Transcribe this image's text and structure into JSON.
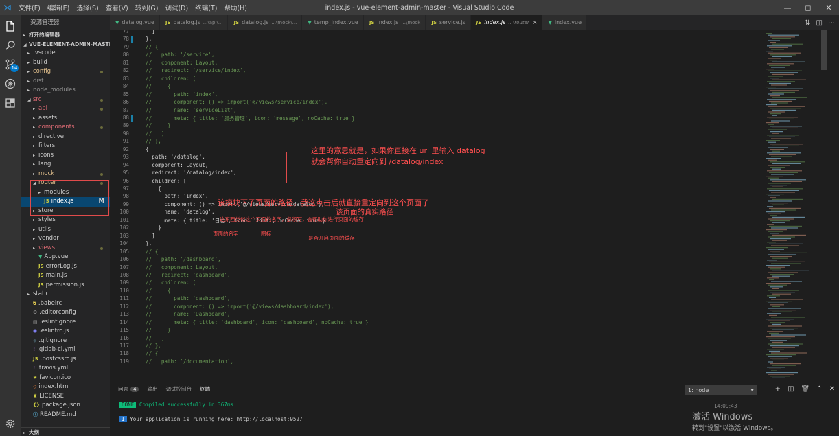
{
  "titlebar": {
    "menu": [
      "文件(F)",
      "编辑(E)",
      "选择(S)",
      "查看(V)",
      "转到(G)",
      "调试(D)",
      "终端(T)",
      "帮助(H)"
    ],
    "title": "index.js - vue-element-admin-master - Visual Studio Code",
    "controls": [
      "—",
      "◻",
      "✕"
    ]
  },
  "activity": {
    "scm_badge": "14"
  },
  "sidebar": {
    "header": "资源管理器",
    "open_editors": "打开的编辑器",
    "project": "VUE-ELEMENT-ADMIN-MASTER",
    "items": [
      {
        "name": ".vscode",
        "indent": 1,
        "type": "folder"
      },
      {
        "name": "build",
        "indent": 1,
        "type": "folder"
      },
      {
        "name": "config",
        "indent": 1,
        "type": "folder",
        "color": "#e2c08d",
        "dot": true
      },
      {
        "name": "dist",
        "indent": 1,
        "type": "folder",
        "color": "#8c8c8c"
      },
      {
        "name": "node_modules",
        "indent": 1,
        "type": "folder",
        "color": "#8c8c8c"
      },
      {
        "name": "src",
        "indent": 1,
        "type": "folder-open",
        "color": "#e06c75",
        "dot": true
      },
      {
        "name": "api",
        "indent": 2,
        "type": "folder",
        "color": "#e06c75",
        "dot": true
      },
      {
        "name": "assets",
        "indent": 2,
        "type": "folder"
      },
      {
        "name": "components",
        "indent": 2,
        "type": "folder",
        "color": "#e06c75",
        "dot": true
      },
      {
        "name": "directive",
        "indent": 2,
        "type": "folder"
      },
      {
        "name": "filters",
        "indent": 2,
        "type": "folder"
      },
      {
        "name": "icons",
        "indent": 2,
        "type": "folder"
      },
      {
        "name": "lang",
        "indent": 2,
        "type": "folder"
      },
      {
        "name": "mock",
        "indent": 2,
        "type": "folder",
        "color": "#e2c08d",
        "dot": true
      },
      {
        "name": "router",
        "indent": 2,
        "type": "folder-open",
        "color": "#e2c08d",
        "dot": true
      },
      {
        "name": "modules",
        "indent": 3,
        "type": "folder"
      },
      {
        "name": "index.js",
        "indent": 3,
        "type": "js",
        "mod": "M",
        "selected": true
      },
      {
        "name": "store",
        "indent": 2,
        "type": "folder"
      },
      {
        "name": "styles",
        "indent": 2,
        "type": "folder"
      },
      {
        "name": "utils",
        "indent": 2,
        "type": "folder"
      },
      {
        "name": "vendor",
        "indent": 2,
        "type": "folder"
      },
      {
        "name": "views",
        "indent": 2,
        "type": "folder",
        "color": "#e06c75",
        "dot": true
      },
      {
        "name": "App.vue",
        "indent": 2,
        "type": "vue"
      },
      {
        "name": "errorLog.js",
        "indent": 2,
        "type": "js"
      },
      {
        "name": "main.js",
        "indent": 2,
        "type": "js"
      },
      {
        "name": "permission.js",
        "indent": 2,
        "type": "js"
      },
      {
        "name": "static",
        "indent": 1,
        "type": "folder"
      },
      {
        "name": ".babelrc",
        "indent": 1,
        "type": "babel"
      },
      {
        "name": ".editorconfig",
        "indent": 1,
        "type": "gear"
      },
      {
        "name": ".eslintignore",
        "indent": 1,
        "type": "plain"
      },
      {
        "name": ".eslintrc.js",
        "indent": 1,
        "type": "eslint"
      },
      {
        "name": ".gitignore",
        "indent": 1,
        "type": "git"
      },
      {
        "name": ".gitlab-ci.yml",
        "indent": 1,
        "type": "yml"
      },
      {
        "name": ".postcssrc.js",
        "indent": 1,
        "type": "js"
      },
      {
        "name": ".travis.yml",
        "indent": 1,
        "type": "yml"
      },
      {
        "name": "favicon.ico",
        "indent": 1,
        "type": "star"
      },
      {
        "name": "index.html",
        "indent": 1,
        "type": "html"
      },
      {
        "name": "LICENSE",
        "indent": 1,
        "type": "license"
      },
      {
        "name": "package.json",
        "indent": 1,
        "type": "json"
      },
      {
        "name": "README.md",
        "indent": 1,
        "type": "info"
      }
    ],
    "outline": "大纲"
  },
  "tabs": [
    {
      "label": "datalog.vue",
      "type": "vue"
    },
    {
      "label": "datalog.js",
      "hint": "...\\api\\...",
      "type": "js"
    },
    {
      "label": "datalog.js",
      "hint": "...\\mock\\...",
      "type": "js"
    },
    {
      "label": "temp_index.vue",
      "type": "vue"
    },
    {
      "label": "index.js",
      "hint": "...\\mock",
      "type": "js"
    },
    {
      "label": "service.js",
      "type": "js"
    },
    {
      "label": "index.js",
      "hint": "...\\router",
      "type": "js",
      "active": true
    },
    {
      "label": "index.vue",
      "type": "vue"
    }
  ],
  "editor": {
    "lines": [
      {
        "n": "77",
        "t": "  ]"
      },
      {
        "n": "78",
        "t": "},",
        "gm": true
      },
      {
        "n": "79",
        "t": "// {"
      },
      {
        "n": "80",
        "t": "//   path: '/service',"
      },
      {
        "n": "81",
        "t": "//   component: Layout,"
      },
      {
        "n": "82",
        "t": "//   redirect: '/service/index',"
      },
      {
        "n": "83",
        "t": "//   children: ["
      },
      {
        "n": "84",
        "t": "//     {"
      },
      {
        "n": "85",
        "t": "//       path: 'index',"
      },
      {
        "n": "86",
        "t": "//       component: () => import('@/views/service/index'),"
      },
      {
        "n": "87",
        "t": "//       name: 'serviceList',"
      },
      {
        "n": "88",
        "t": "//       meta: { title: '服务管理', icon: 'message', noCache: true }",
        "gm": true
      },
      {
        "n": "89",
        "t": "//     }"
      },
      {
        "n": "90",
        "t": "//   ]"
      },
      {
        "n": "91",
        "t": "// },"
      },
      {
        "n": "92",
        "t": "{"
      },
      {
        "n": "93",
        "t": "  path: '/datalog',"
      },
      {
        "n": "94",
        "t": "  component: Layout,"
      },
      {
        "n": "95",
        "t": "  redirect: '/datalog/index',"
      },
      {
        "n": "96",
        "t": "  children: ["
      },
      {
        "n": "97",
        "t": "    {"
      },
      {
        "n": "98",
        "t": "      path: 'index',"
      },
      {
        "n": "99",
        "t": "      component: () => import('@/views/service/datalog'),"
      },
      {
        "n": "100",
        "t": "      name: 'datalog',"
      },
      {
        "n": "101",
        "t": "      meta: { title: '日志', icon: 'list', noCache: true }"
      },
      {
        "n": "102",
        "t": "    }"
      },
      {
        "n": "103",
        "t": "  ]"
      },
      {
        "n": "104",
        "t": "},"
      },
      {
        "n": "105",
        "t": "// {"
      },
      {
        "n": "106",
        "t": "//   path: '/dashboard',"
      },
      {
        "n": "107",
        "t": "//   component: Layout,"
      },
      {
        "n": "108",
        "t": "//   redirect: 'dashboard',"
      },
      {
        "n": "109",
        "t": "//   children: ["
      },
      {
        "n": "110",
        "t": "//     {"
      },
      {
        "n": "111",
        "t": "//       path: 'dashboard',"
      },
      {
        "n": "112",
        "t": "//       component: () => import('@/views/dashboard/index'),"
      },
      {
        "n": "113",
        "t": "//       name: 'Dashboard',"
      },
      {
        "n": "114",
        "t": "//       meta: { title: 'dashboard', icon: 'dashboard', noCache: true }"
      },
      {
        "n": "115",
        "t": "//     }"
      },
      {
        "n": "116",
        "t": "//   ]"
      },
      {
        "n": "117",
        "t": "// },"
      },
      {
        "n": "118",
        "t": "// {"
      },
      {
        "n": "119",
        "t": "//   path: '/documentation',"
      }
    ],
    "annotations": {
      "a1_line1": "这里的意思就是，如果你直接在 url 里输入 datalog",
      "a1_line2": "就会帮你自动重定向到 /datalog/index",
      "a2": "该模块下子页面的路径，我这点击后就直接重定向到这个页面了",
      "a3": "该页面的真实路径",
      "a4": "这东西类似这个页面的名字，必须写，会帮助你进行页面的缓存",
      "a5": "页面的名字",
      "a6": "图标",
      "a7": "是否开启页面的缓存"
    }
  },
  "panel": {
    "tabs": [
      "问题",
      "输出",
      "调试控制台",
      "终端"
    ],
    "problems_count": "4",
    "terminal_select": "1: node",
    "line1_badge": "DONE",
    "line1_text": " Compiled successfully in 367ms",
    "line2_badge": "I",
    "line2_text": " Your application is running here: http://localhost:9527",
    "time": "14:09:43",
    "watermark1": "激活 Windows",
    "watermark2": "转到\"设置\"以激活 Windows。"
  }
}
